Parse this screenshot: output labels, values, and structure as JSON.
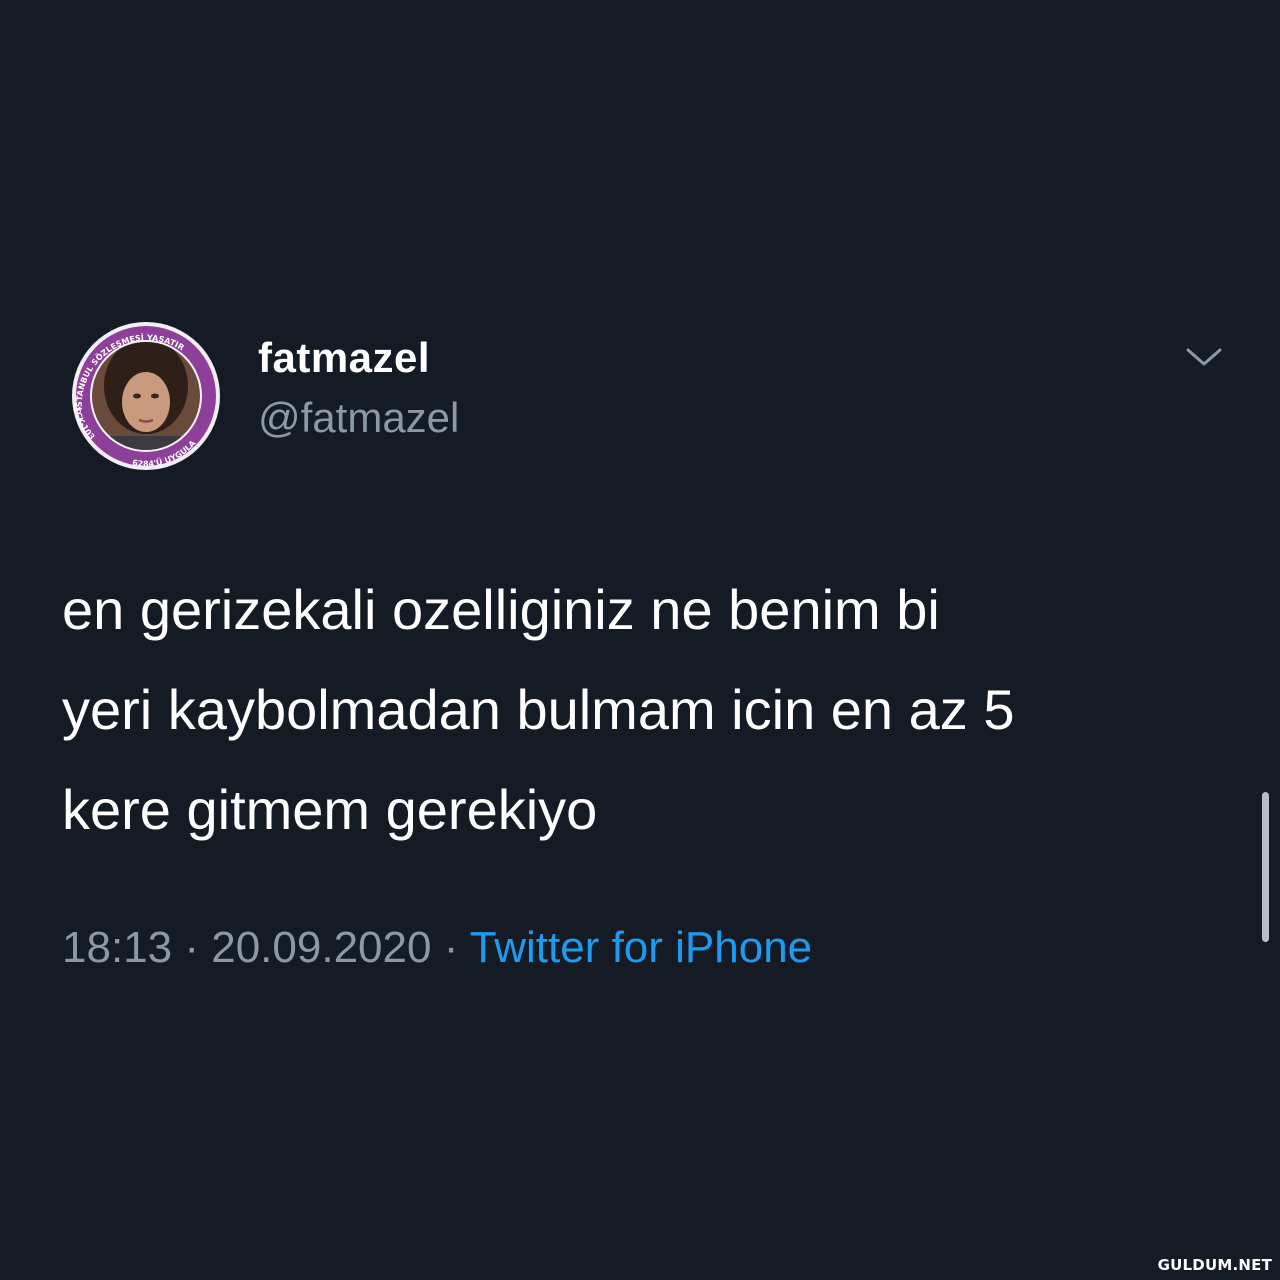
{
  "tweet": {
    "display_name": "fatmazel",
    "handle": "@fatmazel",
    "text": "en gerizekali ozelliginiz ne benim bi\nyeri kaybolmadan bulmam icin en az 5\nkere gitmem gerekiyo",
    "time": "18:13",
    "date": "20.09.2020",
    "separator": "·",
    "source": "Twitter for iPhone"
  },
  "avatar": {
    "badge_top_text": "İSTANBUL SÖZLEŞMESİ YAŞATIR",
    "badge_left_text": "TCK-103",
    "badge_bottom_text": "6284'Ü UYGULA",
    "ring_color": "#8e3f9a"
  },
  "icons": {
    "menu": "chevron-down-icon"
  },
  "colors": {
    "background": "#151b25",
    "muted_text": "#8b98a5",
    "link": "#1d9bf0"
  },
  "watermark": "GULDUM.NET"
}
